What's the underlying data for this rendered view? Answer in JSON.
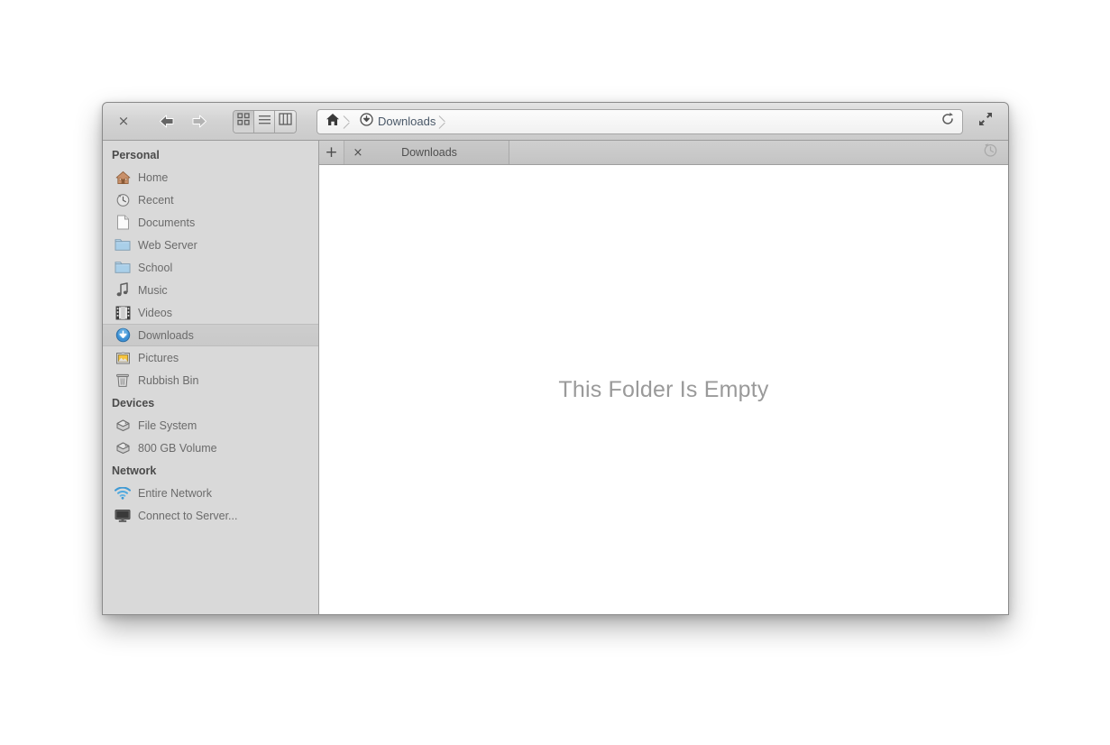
{
  "window": {
    "close_label": "×",
    "back_icon": "back-arrow-icon",
    "forward_icon": "forward-arrow-icon",
    "maximize_icon": "maximize-icon"
  },
  "toolbar": {
    "view_modes": [
      {
        "name": "icon-view",
        "icon": "grid-icon",
        "active": true
      },
      {
        "name": "list-view",
        "icon": "list-icon",
        "active": false
      },
      {
        "name": "column-view",
        "icon": "columns-icon",
        "active": false
      }
    ],
    "reload_icon": "reload-icon"
  },
  "pathbar": {
    "crumbs": [
      {
        "label": "",
        "icon": "home-icon"
      },
      {
        "label": "Downloads",
        "icon": "downloads-circle-icon"
      }
    ]
  },
  "sidebar": {
    "groups": [
      {
        "title": "Personal",
        "items": [
          {
            "label": "Home",
            "icon": "home-house-icon",
            "selected": false
          },
          {
            "label": "Recent",
            "icon": "recent-clock-icon",
            "selected": false
          },
          {
            "label": "Documents",
            "icon": "document-page-icon",
            "selected": false
          },
          {
            "label": "Web Server",
            "icon": "folder-icon",
            "selected": false
          },
          {
            "label": "School",
            "icon": "folder-icon",
            "selected": false
          },
          {
            "label": "Music",
            "icon": "music-note-icon",
            "selected": false
          },
          {
            "label": "Videos",
            "icon": "film-strip-icon",
            "selected": false
          },
          {
            "label": "Downloads",
            "icon": "downloads-circle-icon",
            "selected": true
          },
          {
            "label": "Pictures",
            "icon": "picture-frame-icon",
            "selected": false
          },
          {
            "label": "Rubbish Bin",
            "icon": "trash-bin-icon",
            "selected": false
          }
        ]
      },
      {
        "title": "Devices",
        "items": [
          {
            "label": "File System",
            "icon": "hard-drive-icon",
            "selected": false
          },
          {
            "label": "800 GB Volume",
            "icon": "hard-drive-icon",
            "selected": false
          }
        ]
      },
      {
        "title": "Network",
        "items": [
          {
            "label": "Entire Network",
            "icon": "wifi-icon",
            "selected": false
          },
          {
            "label": "Connect to Server...",
            "icon": "monitor-icon",
            "selected": false
          }
        ]
      }
    ]
  },
  "tabbar": {
    "new_tab_label": "+",
    "tabs": [
      {
        "title": "Downloads",
        "close_label": "×",
        "active": true
      }
    ],
    "history_icon": "history-clock-icon"
  },
  "main": {
    "empty_message": "This Folder Is Empty"
  },
  "colors": {
    "window_chrome": "#d2d2d2",
    "sidebar_bg": "#d9d9d9",
    "selected_row": "#cdcdcd",
    "content_bg": "#ffffff",
    "crumb_text": "#4a5868",
    "sidebar_text": "#6b6b6b",
    "empty_text": "#9a9a9a",
    "accent_blue": "#3b8fd4"
  }
}
